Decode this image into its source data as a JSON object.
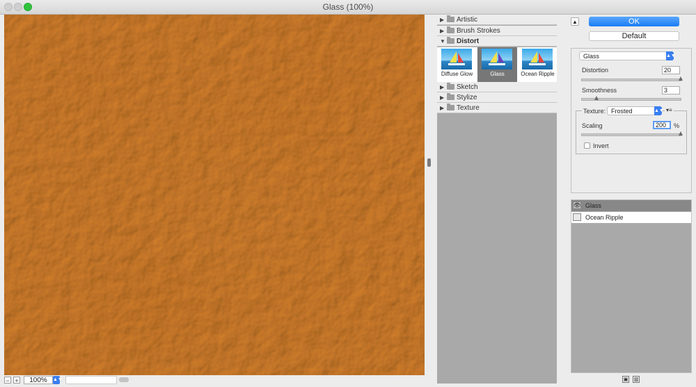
{
  "window": {
    "title": "Glass (100%)"
  },
  "preview": {
    "zoom": "100%",
    "zoom_out_label": "−",
    "zoom_in_label": "+"
  },
  "filter_gallery": {
    "categories_top": [
      {
        "label": "Artistic",
        "expanded": false
      },
      {
        "label": "Brush Strokes",
        "expanded": false
      },
      {
        "label": "Distort",
        "expanded": true
      }
    ],
    "thumbnails": [
      {
        "label": "Diffuse Glow",
        "selected": false
      },
      {
        "label": "Glass",
        "selected": true
      },
      {
        "label": "Ocean Ripple",
        "selected": false
      }
    ],
    "categories_bottom": [
      {
        "label": "Sketch",
        "expanded": false
      },
      {
        "label": "Stylize",
        "expanded": false
      },
      {
        "label": "Texture",
        "expanded": false
      }
    ]
  },
  "buttons": {
    "ok": "OK",
    "default": "Default"
  },
  "settings": {
    "filter_select": "Glass",
    "distortion": {
      "label": "Distortion",
      "value": "20",
      "level": 1.0
    },
    "smoothness": {
      "label": "Smoothness",
      "value": "3",
      "level": 0.15
    },
    "texture": {
      "label": "Texture:",
      "value": "Frosted"
    },
    "scaling": {
      "label": "Scaling",
      "value": "200",
      "unit": "%",
      "level": 1.0
    },
    "invert": {
      "label": "Invert",
      "checked": false
    }
  },
  "effect_layers": [
    {
      "name": "Glass",
      "visible": true,
      "active": true
    },
    {
      "name": "Ocean Ripple",
      "visible": false,
      "active": false
    }
  ],
  "colors": {
    "accent": "#1a7cf4",
    "preview_base": "#d99a4e"
  }
}
